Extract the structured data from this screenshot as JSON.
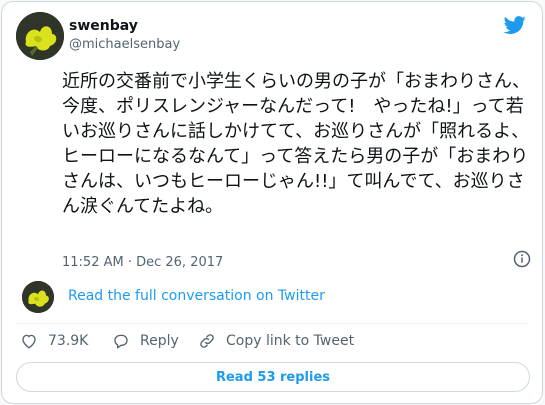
{
  "author": {
    "display_name": "swenbay",
    "handle": "@michaelsenbay"
  },
  "tweet": {
    "text": "近所の交番前で小学生くらいの男の子が「おまわりさん、今度、ポリスレンジャーなんだって!　やったね!」って若いお巡りさんに話しかけてて、お巡りさんが「照れるよ、ヒーローになるなんて」って答えたら男の子が「おまわりさんは、いつもヒーローじゃん!!」て叫んでて、お巡りさん涙ぐんてたよね。",
    "timestamp": "11:52 AM · Dec 26, 2017"
  },
  "conversation": {
    "link_label": "Read the full conversation on Twitter"
  },
  "actions": {
    "likes_count": "73.9K",
    "reply_label": "Reply",
    "copy_link_label": "Copy link to Tweet"
  },
  "replies": {
    "button_label": "Read 53 replies"
  },
  "colors": {
    "accent": "#1d9bf0",
    "text": "#0f1419",
    "muted": "#536471",
    "border": "#cfd9de"
  },
  "icons": {
    "brand": "twitter-bird-icon",
    "info": "info-icon",
    "like": "heart-icon",
    "reply": "reply-bubble-icon",
    "copy_link": "link-icon"
  }
}
